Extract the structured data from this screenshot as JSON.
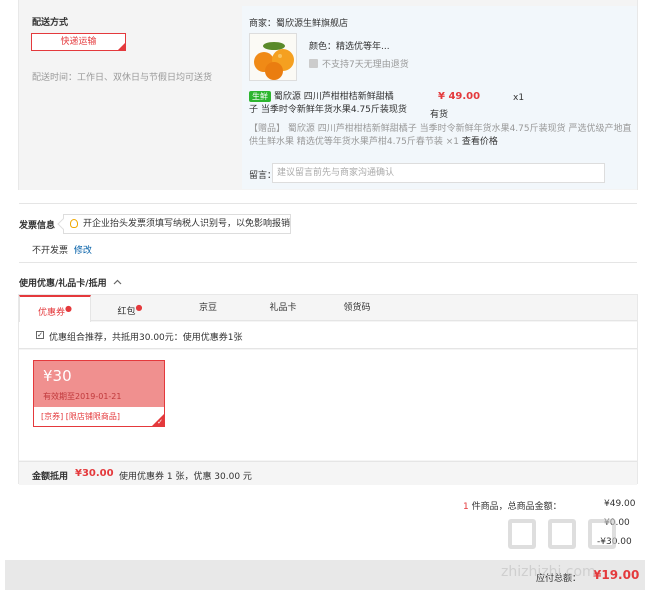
{
  "delivery": {
    "heading": "配送方式",
    "method_button": "快递运输",
    "time_text": "配送时间：工作日、双休日与节假日均可送货"
  },
  "shop": {
    "name": "商家：蜀欣源生鲜旗舰店",
    "color_text": "颜色：精选优等年...",
    "no_return": "不支持7天无理由退货",
    "fresh_badge": "生鲜",
    "product_title_line1": "蜀欣源 四川芦柑柑桔新鲜甜橘",
    "product_title_line2": "子 当季时令新鲜年货水果4.75斤装现货",
    "price": "¥ 49.00",
    "quantity": "x1",
    "stock": "有货",
    "gift_line1": "【赠品】 蜀欣源 四川芦柑柑桔新鲜甜橘子 当季时令新鲜年货水果4.75斤装现货 严选优级产地直",
    "gift_line2": "供生鲜水果 精选优等年货水果芦柑4.75斤春节装 ×1",
    "view_price": "查看价格",
    "remark_label": "留言：",
    "remark_placeholder": "建议留言前先与商家沟通确认"
  },
  "invoice": {
    "heading": "发票信息",
    "tip": "开企业抬头发票须填写纳税人识别号，以免影响报销",
    "value": "不开发票",
    "edit": "修改"
  },
  "discount": {
    "heading": "使用优惠/礼品卡/抵用",
    "tabs": [
      {
        "label": "优惠券",
        "dot": true
      },
      {
        "label": "红包",
        "dot": true
      },
      {
        "label": "京豆",
        "dot": false
      },
      {
        "label": "礼品卡",
        "dot": false
      },
      {
        "label": "领货码",
        "dot": false
      }
    ],
    "combo_text": "优惠组合推荐，共抵用30.00元：使用优惠券1张",
    "coupon": {
      "amount": "¥30",
      "expiry": "有效期至2019-01-21",
      "scope": "[京券]  [限店铺限商品]"
    },
    "sum_label": "金额抵用",
    "sum_value": "¥30.00",
    "sum_detail": "使用优惠券 1 张，优惠 30.00 元"
  },
  "totals": {
    "count": "1",
    "count_text": "件商品，总商品金额：",
    "goods_amount": "¥49.00",
    "freight_amount": "¥0.00",
    "coupon_amount": "-¥30.00",
    "payable_label": "应付总额：",
    "payable_amount": "¥19.00"
  },
  "watermark": {
    "text": "zhizhizhi.com"
  },
  "colors": {
    "accent": "#e4393c",
    "shop_bg": "#f2f7fb",
    "coupon_bg": "#f0908f"
  }
}
